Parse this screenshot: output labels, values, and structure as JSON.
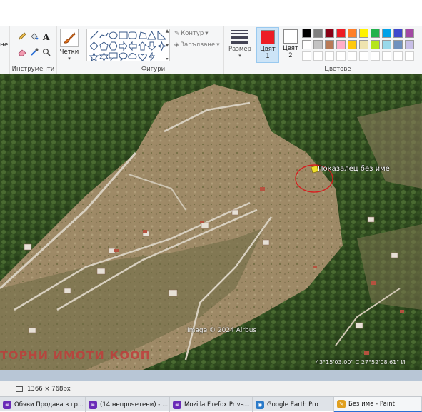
{
  "ribbon": {
    "left_cut_label": "не",
    "groups": {
      "tools": "Инструменти",
      "shapes": "Фигури",
      "colors": "Цветове"
    },
    "brushes_label": "Четки",
    "outline_label": "Контур",
    "fill_label": "Запълване",
    "size_label": "Размер",
    "color1_label": "Цвят\n1",
    "color1_line1": "Цвят",
    "color1_line2": "1",
    "color2_line1": "Цвят",
    "color2_line2": "2",
    "color1_value": "#ed1c24",
    "color2_value": "#ffffff",
    "palette_row1": [
      "#000000",
      "#7f7f7f",
      "#880015",
      "#ed1c24",
      "#ff7f27",
      "#fff200",
      "#22b14c",
      "#00a2e8",
      "#3f48cc",
      "#a349a4"
    ],
    "palette_row2": [
      "#ffffff",
      "#c3c3c3",
      "#b97a57",
      "#ffaec9",
      "#ffc90e",
      "#efe4b0",
      "#b5e61d",
      "#99d9ea",
      "#7092be",
      "#c8bfe7"
    ],
    "palette_row3": [
      "#ffffff",
      "#ffffff",
      "#ffffff",
      "#ffffff",
      "#ffffff",
      "#ffffff",
      "#ffffff",
      "#ffffff",
      "#ffffff",
      "#ffffff"
    ]
  },
  "canvas": {
    "placemark_label": "Показалец без име",
    "imagery_credit": "Image © 2024 Airbus",
    "coordinates": "43°15'03.00\" С   27°52'08.61\" И",
    "bottom_text": "ТОРНИ ИМОТИ КООП"
  },
  "status": {
    "dimensions": "1366 × 768px"
  },
  "taskbar": {
    "items": [
      {
        "label": "Обяви Продава в гр...",
        "icon": "firefox-private-icon"
      },
      {
        "label": "(14 непрочетени) - ...",
        "icon": "firefox-private-icon"
      },
      {
        "label": "Mozilla Firefox Priva...",
        "icon": "firefox-private-icon"
      },
      {
        "label": "Google Earth Pro",
        "icon": "google-earth-icon"
      },
      {
        "label": "Без име - Paint",
        "icon": "paint-icon"
      }
    ]
  }
}
